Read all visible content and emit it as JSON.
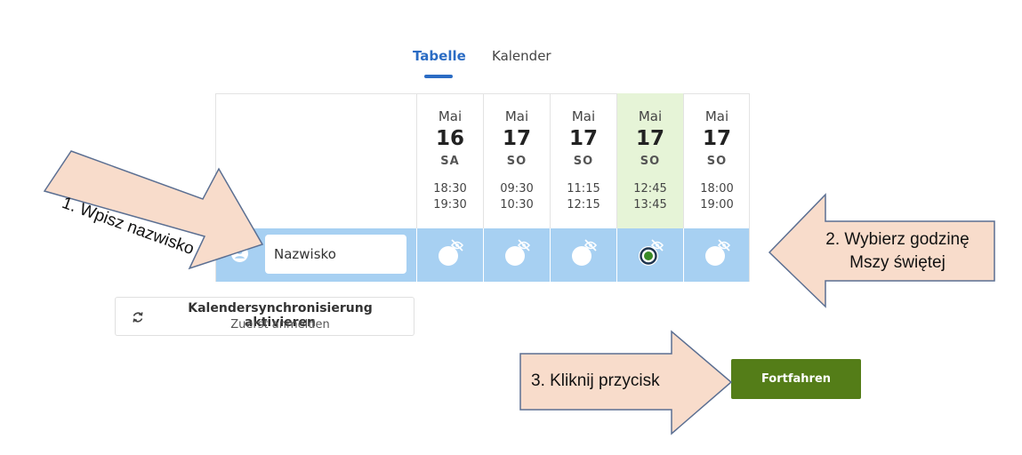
{
  "tabs": [
    {
      "label": "Tabelle",
      "active": true
    },
    {
      "label": "Kalender",
      "active": false
    }
  ],
  "columns": [
    {
      "month": "Mai",
      "day": "16",
      "weekday": "SA",
      "start": "18:30",
      "end": "19:30",
      "selected": false
    },
    {
      "month": "Mai",
      "day": "17",
      "weekday": "SO",
      "start": "09:30",
      "end": "10:30",
      "selected": false
    },
    {
      "month": "Mai",
      "day": "17",
      "weekday": "SO",
      "start": "11:15",
      "end": "12:15",
      "selected": false
    },
    {
      "month": "Mai",
      "day": "17",
      "weekday": "SO",
      "start": "12:45",
      "end": "13:45",
      "selected": true
    },
    {
      "month": "Mai",
      "day": "17",
      "weekday": "SO",
      "start": "18:00",
      "end": "19:00",
      "selected": false
    }
  ],
  "name_input": {
    "placeholder": "Nazwisko",
    "value": ""
  },
  "sync_button": {
    "title": "Kalendersynchronisierung aktivieren",
    "subtitle": "Zuerst anmelden"
  },
  "continue_button": {
    "label": "Fortfahren"
  },
  "annotations": {
    "step1": "1. Wpisz nazwisko",
    "step2_line1": "2. Wybierz godzinę",
    "step2_line2": "Mszy świętej",
    "step3": "3. Kliknij przycisk"
  },
  "colors": {
    "accent": "#2b6cc4",
    "row_blue": "#a7d0f2",
    "highlight": "#e6f4d7",
    "continue": "#547d18",
    "annotation_fill": "#f8dccb",
    "selected_dot": "#3a8a26"
  },
  "icons": {
    "user": "user-circle-icon",
    "hidden": "eye-off-icon",
    "sync": "sync-icon"
  }
}
